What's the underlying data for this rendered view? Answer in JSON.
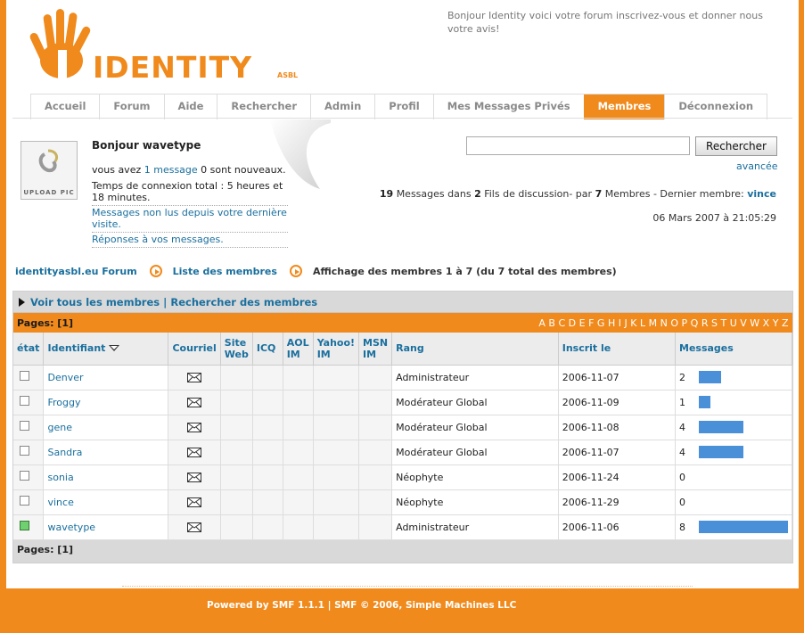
{
  "header": {
    "logo_letters": "IDENTITY",
    "logo_sub": "ASBL",
    "welcome": "Bonjour Identity voici votre forum inscrivez-vous et donner nous votre avis!"
  },
  "menu": [
    {
      "label": "Accueil",
      "active": false
    },
    {
      "label": "Forum",
      "active": false
    },
    {
      "label": "Aide",
      "active": false
    },
    {
      "label": "Rechercher",
      "active": false
    },
    {
      "label": "Admin",
      "active": false
    },
    {
      "label": "Profil",
      "active": false
    },
    {
      "label": "Mes Messages Privés",
      "active": false
    },
    {
      "label": "Membres",
      "active": true
    },
    {
      "label": "Déconnexion",
      "active": false
    }
  ],
  "user": {
    "avatar_label": "UPLOAD PIC",
    "greeting": "Bonjour wavetype",
    "messages_prefix": "vous avez",
    "messages_link": "1 message",
    "messages_suffix": "0 sont nouveaux.",
    "connection_time": "Temps de connexion total : 5 heures et 18 minutes.",
    "unread_link": "Messages non lus depuis votre dernière visite.",
    "replies_link": "Réponses à vos messages."
  },
  "search": {
    "value": "",
    "button": "Rechercher",
    "advanced": "avancée"
  },
  "stats": {
    "messages_count": "19",
    "messages_label": "Messages dans",
    "threads_count": "2",
    "threads_label": "Fils de discussion- par",
    "members_count": "7",
    "members_label": "Membres - Dernier membre:",
    "last_member": "vince",
    "date": "06 Mars 2007 à 21:05:29"
  },
  "breadcrumb": {
    "forum": "identityasbl.eu Forum",
    "list": "Liste des membres",
    "current": "Affichage des membres 1 à 7 (du 7 total des membres)"
  },
  "memberlist": {
    "view_all": "Voir tous les membres",
    "separator": "|",
    "search_members": "Rechercher des membres",
    "pages_label": "Pages: [1]",
    "letters": [
      "A",
      "B",
      "C",
      "D",
      "E",
      "F",
      "G",
      "H",
      "I",
      "J",
      "K",
      "L",
      "M",
      "N",
      "O",
      "P",
      "Q",
      "R",
      "S",
      "T",
      "U",
      "V",
      "W",
      "X",
      "Y",
      "Z"
    ],
    "headers": {
      "status": "état",
      "name": "Identifiant",
      "email": "Courriel",
      "website": "Site Web",
      "icq": "ICQ",
      "aol": "AOL IM",
      "yahoo": "Yahoo! IM",
      "msn": "MSN IM",
      "rank": "Rang",
      "registered": "Inscrit le",
      "posts": "Messages"
    },
    "rows": [
      {
        "name": "Denver",
        "rank": "Administrateur",
        "registered": "2006-11-07",
        "posts": "2",
        "bar": 0.25,
        "online": false
      },
      {
        "name": "Froggy",
        "rank": "Modérateur Global",
        "registered": "2006-11-09",
        "posts": "1",
        "bar": 0.125,
        "online": false
      },
      {
        "name": "gene",
        "rank": "Modérateur Global",
        "registered": "2006-11-08",
        "posts": "4",
        "bar": 0.5,
        "online": false
      },
      {
        "name": "Sandra",
        "rank": "Modérateur Global",
        "registered": "2006-11-07",
        "posts": "4",
        "bar": 0.5,
        "online": false
      },
      {
        "name": "sonia",
        "rank": "Néophyte",
        "registered": "2006-11-24",
        "posts": "0",
        "bar": 0,
        "online": false
      },
      {
        "name": "vince",
        "rank": "Néophyte",
        "registered": "2006-11-29",
        "posts": "0",
        "bar": 0,
        "online": false
      },
      {
        "name": "wavetype",
        "rank": "Administrateur",
        "registered": "2006-11-06",
        "posts": "8",
        "bar": 1.0,
        "online": true
      }
    ],
    "pages_bottom": "Pages: [1]"
  },
  "footer": {
    "text": "Powered by SMF 1.1.1 | SMF © 2006, Simple Machines LLC"
  },
  "colors": {
    "accent": "#f08a1c",
    "link": "#1a6f9e",
    "bar": "#4a90d9"
  }
}
